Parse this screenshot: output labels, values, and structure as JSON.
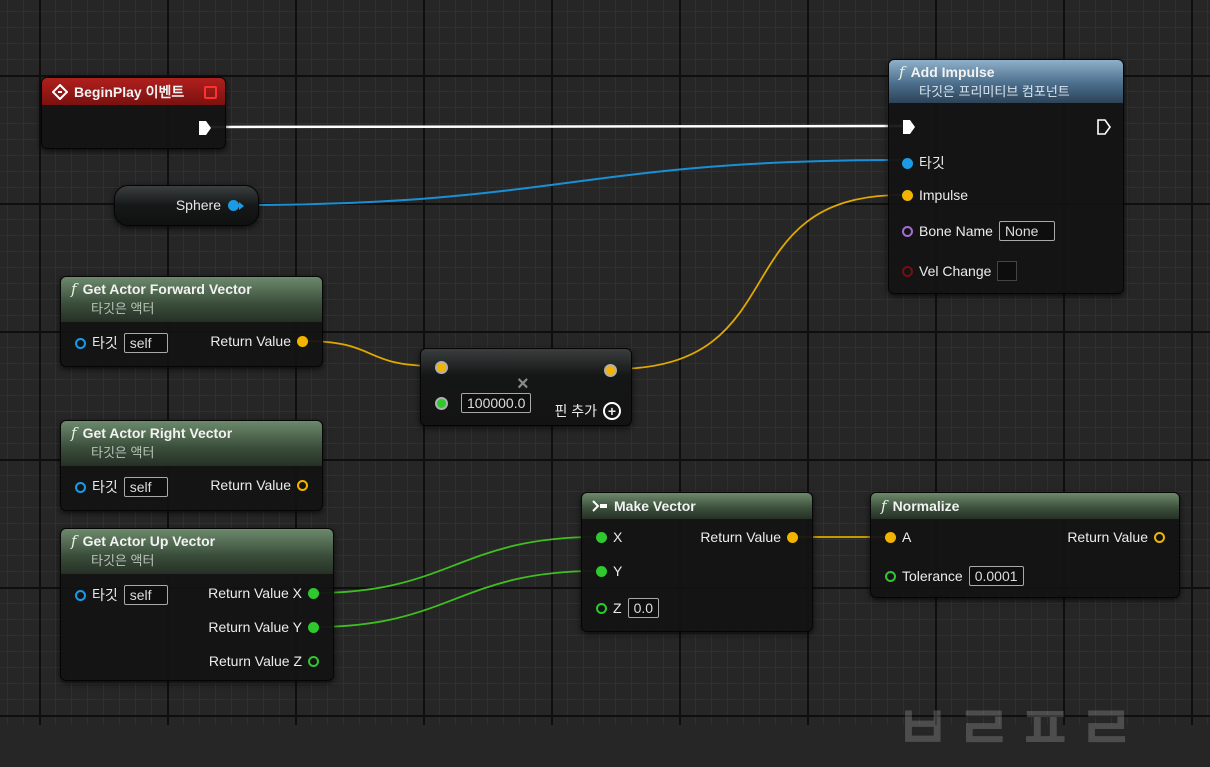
{
  "begin_play": {
    "title": "BeginPlay 이벤트"
  },
  "sphere": {
    "label": "Sphere"
  },
  "add_impulse": {
    "title": "Add Impulse",
    "subtitle": "타깃은 프리미티브 컴포넌트",
    "pins": {
      "target": "타깃",
      "impulse": "Impulse",
      "bone_name": "Bone Name",
      "bone_name_value": "None",
      "vel_change": "Vel Change"
    }
  },
  "get_forward": {
    "title": "Get Actor Forward Vector",
    "subtitle": "타깃은 액터",
    "target": "타깃",
    "target_value": "self",
    "return": "Return Value"
  },
  "get_right": {
    "title": "Get Actor Right Vector",
    "subtitle": "타깃은 액터",
    "target": "타깃",
    "target_value": "self",
    "return": "Return Value"
  },
  "get_up": {
    "title": "Get Actor Up Vector",
    "subtitle": "타깃은 액터",
    "target": "타깃",
    "target_value": "self",
    "return_x": "Return Value X",
    "return_y": "Return Value Y",
    "return_z": "Return Value Z"
  },
  "multiply": {
    "value": "100000.0",
    "add_pin": "핀 추가"
  },
  "make_vector": {
    "title": "Make Vector",
    "x": "X",
    "y": "Y",
    "z": "Z",
    "z_value": "0.0",
    "return": "Return Value"
  },
  "normalize": {
    "title": "Normalize",
    "a": "A",
    "tolerance": "Tolerance",
    "tolerance_value": "0.0001",
    "return": "Return Value"
  },
  "watermark": "ㅂㄹㅍㄹ",
  "colors": {
    "exec": "#ffffff",
    "object": "#1a9be6",
    "vector": "#f2b400",
    "float": "#2dc92d",
    "name": "#a86bd6",
    "bool": "#7a0d0d"
  }
}
